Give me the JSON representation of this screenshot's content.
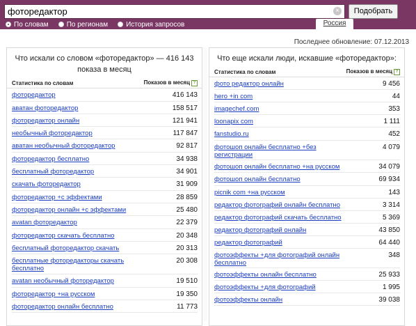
{
  "search": {
    "value": "фоторедактор",
    "clear_symbol": "×",
    "submit_label": "Подобрать"
  },
  "modes": [
    {
      "label": "По словам",
      "active": true
    },
    {
      "label": "По регионам",
      "active": false
    },
    {
      "label": "История запросов",
      "active": false
    }
  ],
  "region_label": "Россия",
  "last_update": "Последнее обновление: 07.12.2013",
  "left_panel": {
    "title": "Что искали со словом «фоторедактор» — 416 143 показа в месяц",
    "col_words": "Статистика по словам",
    "col_shows": "Показов в месяц",
    "help_symbol": "?",
    "rows": [
      {
        "q": "фоторедактор",
        "n": "416 143"
      },
      {
        "q": "аватан фоторедактор",
        "n": "158 517"
      },
      {
        "q": "фоторедактор онлайн",
        "n": "121 941"
      },
      {
        "q": "необычный фоторедактор",
        "n": "117 847"
      },
      {
        "q": "аватан необычный фоторедактор",
        "n": "92 817"
      },
      {
        "q": "фоторедактор бесплатно",
        "n": "34 938"
      },
      {
        "q": "бесплатный фоторедактор",
        "n": "34 901"
      },
      {
        "q": "скачать фоторедактор",
        "n": "31 909"
      },
      {
        "q": "фоторедактор +с эффектами",
        "n": "28 859"
      },
      {
        "q": "фоторедактор онлайн +с эффектами",
        "n": "25 480"
      },
      {
        "q": "avatan фоторедактор",
        "n": "22 379"
      },
      {
        "q": "фоторедактор скачать бесплатно",
        "n": "20 348"
      },
      {
        "q": "бесплатный фоторедактор скачать",
        "n": "20 313"
      },
      {
        "q": "бесплатные фоторедакторы скачать бесплатно",
        "n": "20 308"
      },
      {
        "q": "avatan необычный фоторедактор",
        "n": "19 510"
      },
      {
        "q": "фоторедактор +на русском",
        "n": "19 350"
      },
      {
        "q": "фоторедактор онлайн бесплатно",
        "n": "11 773"
      }
    ]
  },
  "right_panel": {
    "title": "Что еще искали люди, искавшие «фоторедактор»:",
    "col_words": "Статистика по словам",
    "col_shows": "Показов в месяц",
    "help_symbol": "?",
    "rows": [
      {
        "q": "фото редактор онлайн",
        "n": "9 456"
      },
      {
        "q": "hero +in com",
        "n": "44"
      },
      {
        "q": "imagechef.com",
        "n": "353"
      },
      {
        "q": "loonapix com",
        "n": "1 111"
      },
      {
        "q": "fanstudio.ru",
        "n": "452"
      },
      {
        "q": "фотошоп онлайн бесплатно +без регистрации",
        "n": "4 079"
      },
      {
        "q": "фотошоп онлайн бесплатно +на русском",
        "n": "34 079"
      },
      {
        "q": "фотошоп онлайн бесплатно",
        "n": "69 934"
      },
      {
        "q": "picnik com +на русском",
        "n": "143"
      },
      {
        "q": "редактор фотографий онлайн бесплатно",
        "n": "3 314"
      },
      {
        "q": "редактор фотографий скачать бесплатно",
        "n": "5 369"
      },
      {
        "q": "редактор фотографий онлайн",
        "n": "43 850"
      },
      {
        "q": "редактор фотографий",
        "n": "64 440"
      },
      {
        "q": "фотоэффекты +для фотографий онлайн бесплатно",
        "n": "348"
      },
      {
        "q": "фотоэффекты онлайн бесплатно",
        "n": "25 933"
      },
      {
        "q": "фотоэффекты +для фотографий",
        "n": "1 995"
      },
      {
        "q": "фотоэффекты онлайн",
        "n": "39 038"
      }
    ]
  }
}
